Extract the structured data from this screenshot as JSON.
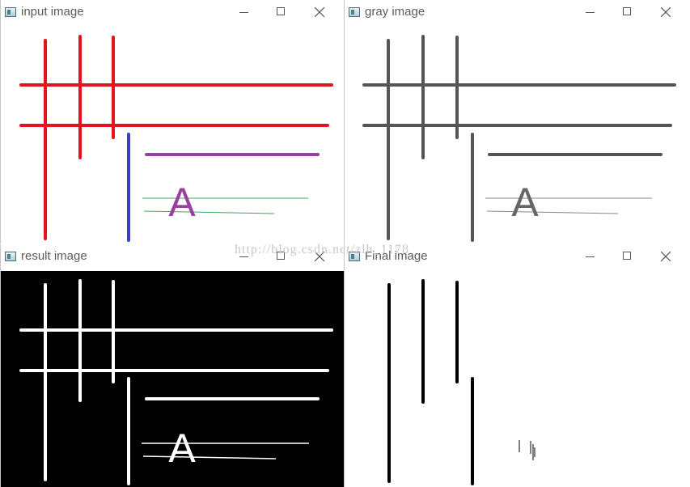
{
  "windows": {
    "input": {
      "title": "input image"
    },
    "gray": {
      "title": "gray image"
    },
    "result": {
      "title": "result image"
    },
    "final": {
      "title": "Final image"
    }
  },
  "canvas_letter": "A",
  "watermark": "http://blog.csdn.net/zlh_1178",
  "colors": {
    "red_lines": "#e3141b",
    "blue_line": "#3a3fcc",
    "purple": "#9a3fa0",
    "green_lines": "#3fa85a",
    "gray_lines": "#555555",
    "gray_light": "#aaaaaa",
    "result_bg": "#000000",
    "result_lines": "#ffffff",
    "final_lines": "#000000"
  },
  "icons": [
    "app-icon",
    "minimize-icon",
    "maximize-icon",
    "close-icon"
  ]
}
